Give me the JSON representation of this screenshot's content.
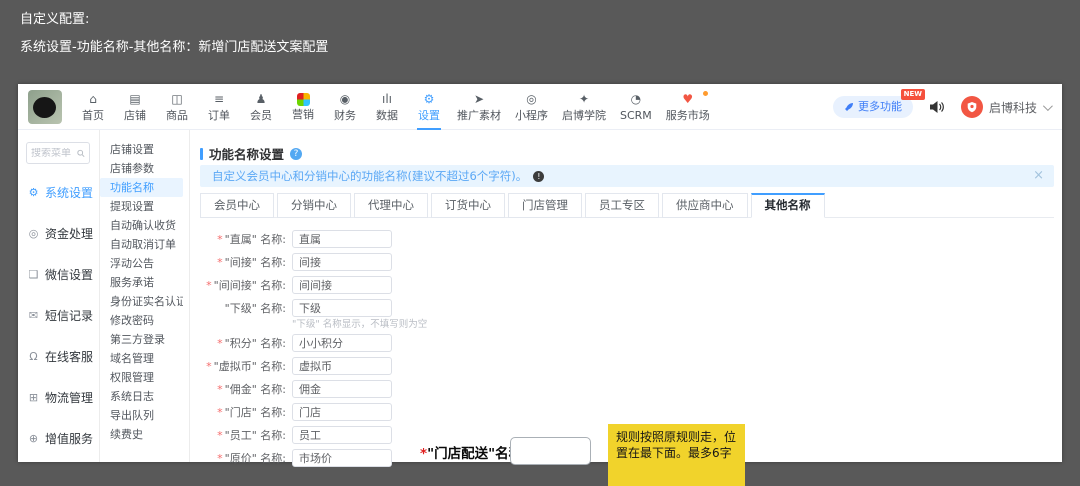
{
  "accent": "#409eff",
  "note_yellow": "#f1d32b",
  "outer": {
    "heading1": "自定义配置:",
    "heading2": "系统设置-功能名称-其他名称：新增门店配送文案配置"
  },
  "topnav": {
    "items": [
      {
        "key": "home",
        "label": "首页",
        "glyph": "⌂"
      },
      {
        "key": "store",
        "label": "店铺",
        "glyph": "▤"
      },
      {
        "key": "goods",
        "label": "商品",
        "glyph": "◫"
      },
      {
        "key": "orders",
        "label": "订单",
        "glyph": "≡"
      },
      {
        "key": "members",
        "label": "会员",
        "glyph": "♟"
      },
      {
        "key": "marketing",
        "label": "营销",
        "glyph": "",
        "style": "grid"
      },
      {
        "key": "finance",
        "label": "财务",
        "glyph": "◉"
      },
      {
        "key": "data",
        "label": "数据",
        "glyph": "ılı"
      },
      {
        "key": "settings",
        "label": "设置",
        "glyph": "⚙",
        "active": true
      },
      {
        "key": "promo-material",
        "label": "推广素材",
        "glyph": "➤"
      },
      {
        "key": "mini-program",
        "label": "小程序",
        "glyph": "◎"
      },
      {
        "key": "academy",
        "label": "启博学院",
        "glyph": "✦"
      },
      {
        "key": "scrm",
        "label": "SCRM",
        "glyph": "◔"
      },
      {
        "key": "service-market",
        "label": "服务市场",
        "glyph": "♥",
        "style": "market",
        "badge": true
      }
    ],
    "more_button": "更多功能",
    "new_badge": "NEW",
    "account_name": "启博科技"
  },
  "sidebar": {
    "search_placeholder": "搜索菜单",
    "items": [
      {
        "key": "system-settings",
        "label": "系统设置",
        "glyph": "⚙",
        "active": true
      },
      {
        "key": "funds",
        "label": "资金处理",
        "glyph": "◎"
      },
      {
        "key": "wechat-settings",
        "label": "微信设置",
        "glyph": "❑"
      },
      {
        "key": "sms-records",
        "label": "短信记录",
        "glyph": "✉"
      },
      {
        "key": "online-service",
        "label": "在线客服",
        "glyph": "Ω"
      },
      {
        "key": "logistics",
        "label": "物流管理",
        "glyph": "⊞"
      },
      {
        "key": "value-added",
        "label": "增值服务",
        "glyph": "⊕"
      }
    ]
  },
  "submenu": {
    "items": [
      {
        "key": "shop-settings",
        "label": "店铺设置"
      },
      {
        "key": "shop-params",
        "label": "店铺参数"
      },
      {
        "key": "feature-names",
        "label": "功能名称",
        "active": true
      },
      {
        "key": "withdraw-settings",
        "label": "提现设置"
      },
      {
        "key": "auto-confirm-receipt",
        "label": "自动确认收货"
      },
      {
        "key": "auto-cancel-order",
        "label": "自动取消订单"
      },
      {
        "key": "floating-notice",
        "label": "浮动公告"
      },
      {
        "key": "service-promise",
        "label": "服务承诺"
      },
      {
        "key": "id-verification",
        "label": "身份证实名认证"
      },
      {
        "key": "change-password",
        "label": "修改密码"
      },
      {
        "key": "third-party-login",
        "label": "第三方登录"
      },
      {
        "key": "domain-management",
        "label": "域名管理"
      },
      {
        "key": "permission-management",
        "label": "权限管理"
      },
      {
        "key": "system-log",
        "label": "系统日志"
      },
      {
        "key": "export-queue",
        "label": "导出队列"
      },
      {
        "key": "renewal-history",
        "label": "续费史"
      }
    ]
  },
  "main": {
    "title": "功能名称设置",
    "help_glyph": "?",
    "banner_text": "自定义会员中心和分销中心的功能名称(建议不超过6个字符)。",
    "banner_info_glyph": "!",
    "banner_close_glyph": "×",
    "tabs": [
      {
        "key": "member-center",
        "label": "会员中心"
      },
      {
        "key": "distribution-center",
        "label": "分销中心"
      },
      {
        "key": "agent-center",
        "label": "代理中心"
      },
      {
        "key": "ordering-center",
        "label": "订货中心"
      },
      {
        "key": "shop-management",
        "label": "门店管理"
      },
      {
        "key": "staff-zone",
        "label": "员工专区"
      },
      {
        "key": "supplier-center",
        "label": "供应商中心"
      },
      {
        "key": "other-names",
        "label": "其他名称",
        "active": true
      }
    ],
    "fields": [
      {
        "key": "direct",
        "required": true,
        "label": "\"直属\" 名称:",
        "value": "直属"
      },
      {
        "key": "indirect",
        "required": true,
        "label": "\"间接\" 名称:",
        "value": "间接"
      },
      {
        "key": "indirect2",
        "required": true,
        "label": "\"间间接\" 名称:",
        "value": "间间接"
      },
      {
        "key": "subordinate",
        "required": false,
        "label": "\"下级\" 名称:",
        "value": "下级",
        "hint": "\"下级\" 名称显示，不填写则为空"
      },
      {
        "key": "points",
        "required": true,
        "label": "\"积分\" 名称:",
        "value": "小小积分"
      },
      {
        "key": "virtual-currency",
        "required": true,
        "label": "\"虚拟币\" 名称:",
        "value": "虚拟币"
      },
      {
        "key": "commission",
        "required": true,
        "label": "\"佣金\" 名称:",
        "value": "佣金"
      },
      {
        "key": "shop",
        "required": true,
        "label": "\"门店\" 名称:",
        "value": "门店"
      },
      {
        "key": "staff",
        "required": true,
        "label": "\"员工\" 名称:",
        "value": "员工"
      },
      {
        "key": "original-price",
        "required": true,
        "label": "\"原价\" 名称:",
        "value": "市场价"
      }
    ]
  },
  "annotation": {
    "asterisk": "*",
    "label": "\"门店配送\"名称",
    "input_value": "",
    "note": "规则按照原规则走，位置在最下面。最多6字"
  }
}
